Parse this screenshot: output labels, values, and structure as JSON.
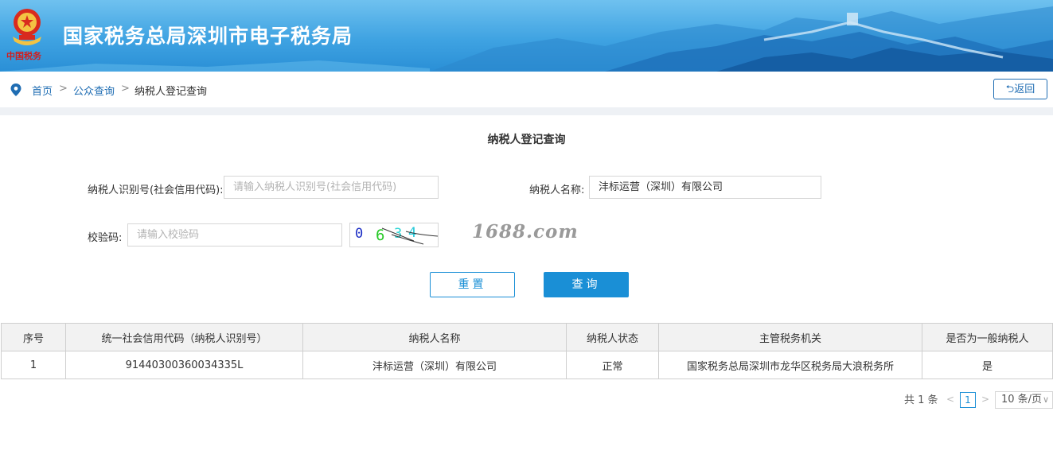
{
  "header": {
    "emblem_text": "中国税务",
    "site_title": "国家税务总局深圳市电子税务局"
  },
  "breadcrumb": {
    "home": "首页",
    "public_query": "公众查询",
    "current": "纳税人登记查询",
    "separator": ">",
    "back_label": "⮌返回"
  },
  "form": {
    "title": "纳税人登记查询",
    "taxpayer_id_label": "纳税人识别号(社会信用代码):",
    "taxpayer_id_placeholder": "请输入纳税人识别号(社会信用代码)",
    "taxpayer_name_label": "纳税人名称:",
    "taxpayer_name_value": "沣标运营（深圳）有限公司",
    "captcha_label": "校验码:",
    "captcha_placeholder": "请输入校验码",
    "captcha_chars": [
      "0",
      "6",
      "3",
      "4"
    ],
    "watermark": "1688.com",
    "reset_label": "重置",
    "query_label": "查询"
  },
  "table": {
    "headers": [
      "序号",
      "统一社会信用代码（纳税人识别号）",
      "纳税人名称",
      "纳税人状态",
      "主管税务机关",
      "是否为一般纳税人"
    ],
    "rows": [
      [
        "1",
        "91440300360034335L",
        "沣标运营（深圳）有限公司",
        "正常",
        "国家税务总局深圳市龙华区税务局大浪税务所",
        "是"
      ]
    ]
  },
  "pagination": {
    "total": "共 1 条",
    "prev": "<",
    "page": "1",
    "next": ">",
    "page_size": "10 条/页"
  },
  "colors": {
    "accent": "#1a8fd6",
    "link": "#1f6db3",
    "header_sky": "#3fa3e2"
  }
}
